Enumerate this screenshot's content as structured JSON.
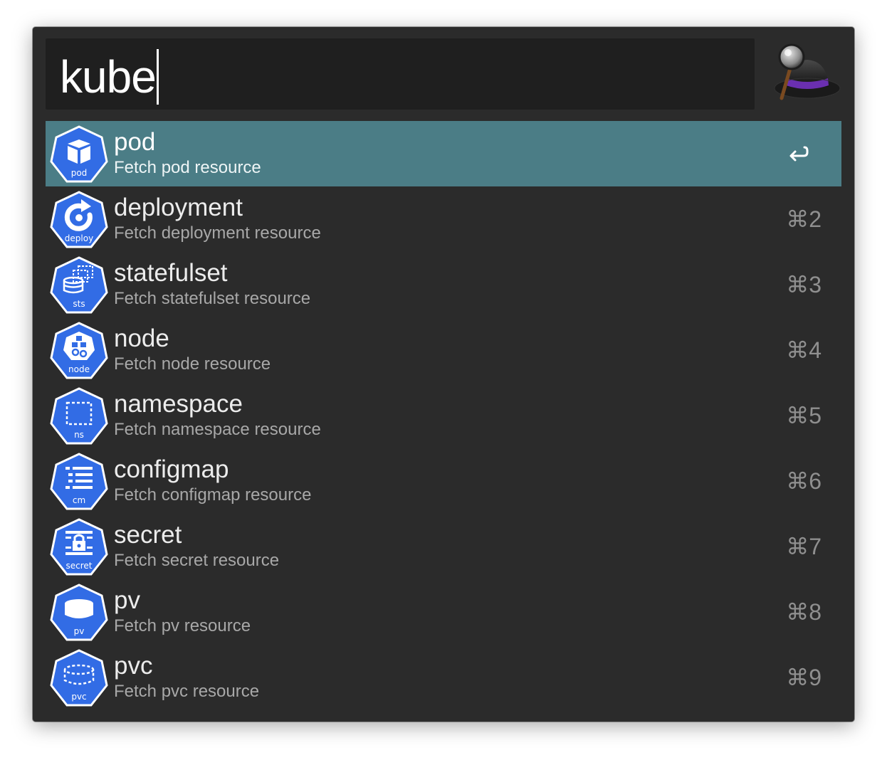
{
  "search": {
    "query": "kube"
  },
  "results": [
    {
      "title": "pod",
      "subtitle": "Fetch pod resource",
      "icon": "pod-icon",
      "badge": "pod",
      "shortcut": "",
      "selected": true
    },
    {
      "title": "deployment",
      "subtitle": "Fetch deployment resource",
      "icon": "deployment-icon",
      "badge": "deploy",
      "shortcut": "⌘2"
    },
    {
      "title": "statefulset",
      "subtitle": "Fetch statefulset resource",
      "icon": "statefulset-icon",
      "badge": "sts",
      "shortcut": "⌘3"
    },
    {
      "title": "node",
      "subtitle": "Fetch node resource",
      "icon": "node-icon",
      "badge": "node",
      "shortcut": "⌘4"
    },
    {
      "title": "namespace",
      "subtitle": "Fetch namespace resource",
      "icon": "namespace-icon",
      "badge": "ns",
      "shortcut": "⌘5"
    },
    {
      "title": "configmap",
      "subtitle": "Fetch configmap resource",
      "icon": "configmap-icon",
      "badge": "cm",
      "shortcut": "⌘6"
    },
    {
      "title": "secret",
      "subtitle": "Fetch secret resource",
      "icon": "secret-icon",
      "badge": "secret",
      "shortcut": "⌘7"
    },
    {
      "title": "pv",
      "subtitle": "Fetch pv resource",
      "icon": "persistent-volume-icon",
      "badge": "pv",
      "shortcut": "⌘8"
    },
    {
      "title": "pvc",
      "subtitle": "Fetch pvc resource",
      "icon": "persistent-volume-claim-icon",
      "badge": "pvc",
      "shortcut": "⌘9"
    }
  ],
  "colors": {
    "window_bg": "#2b2b2b",
    "search_bg": "#1f1f1f",
    "selected_row": "#4b7d86",
    "k8s_blue": "#326ce5",
    "title": "#ececec",
    "subtitle": "#a8a8a8",
    "shortcut": "#8f8f8f"
  }
}
